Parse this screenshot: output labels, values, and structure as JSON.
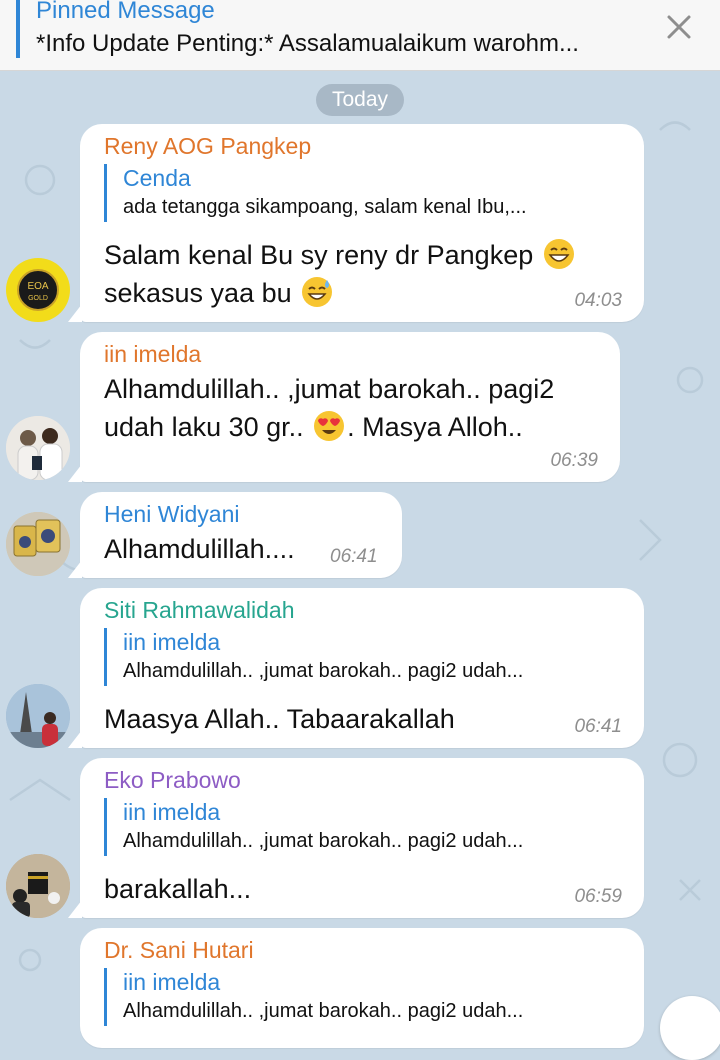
{
  "pinned": {
    "title": "Pinned Message",
    "text": "*Info Update Penting:*  Assalamualaikum warohm..."
  },
  "day_label": "Today",
  "colors": {
    "background": "#c9d9e6",
    "accent": "#2f86d6",
    "sender_orange": "#e0762c",
    "sender_blue": "#2f86d6",
    "sender_green": "#27a58f",
    "sender_purple": "#8d5cc4"
  },
  "messages": [
    {
      "sender": "Reny AOG Pangkep",
      "reply": {
        "name": "Cenda",
        "text": "ada tetangga sikampoang, salam kenal Ibu,..."
      },
      "line1": "Salam kenal Bu sy reny dr Pangkep",
      "line2": "sekasus yaa bu",
      "time": "04:03",
      "avatar_text_1": "EOA",
      "avatar_text_2": "GOLD"
    },
    {
      "sender": "iin imelda",
      "line1": "Alhamdulillah.. ,jumat barokah.. pagi2",
      "line2a": "udah laku 30 gr..",
      "line2b": ". Masya Alloh..",
      "time": "06:39"
    },
    {
      "sender": "Heni Widyani",
      "line1": "Alhamdulillah....",
      "time": "06:41"
    },
    {
      "sender": "Siti Rahmawalidah",
      "reply": {
        "name": "iin imelda",
        "text": "Alhamdulillah.. ,jumat barokah.. pagi2 udah..."
      },
      "line1": "Maasya Allah.. Tabaarakallah",
      "time": "06:41"
    },
    {
      "sender": "Eko Prabowo",
      "reply": {
        "name": "iin imelda",
        "text": "Alhamdulillah.. ,jumat barokah.. pagi2 udah..."
      },
      "line1": "barakallah...",
      "time": "06:59"
    },
    {
      "sender": "Dr. Sani Hutari",
      "reply": {
        "name": "iin imelda",
        "text": "Alhamdulillah.. ,jumat barokah.. pagi2 udah..."
      }
    }
  ]
}
